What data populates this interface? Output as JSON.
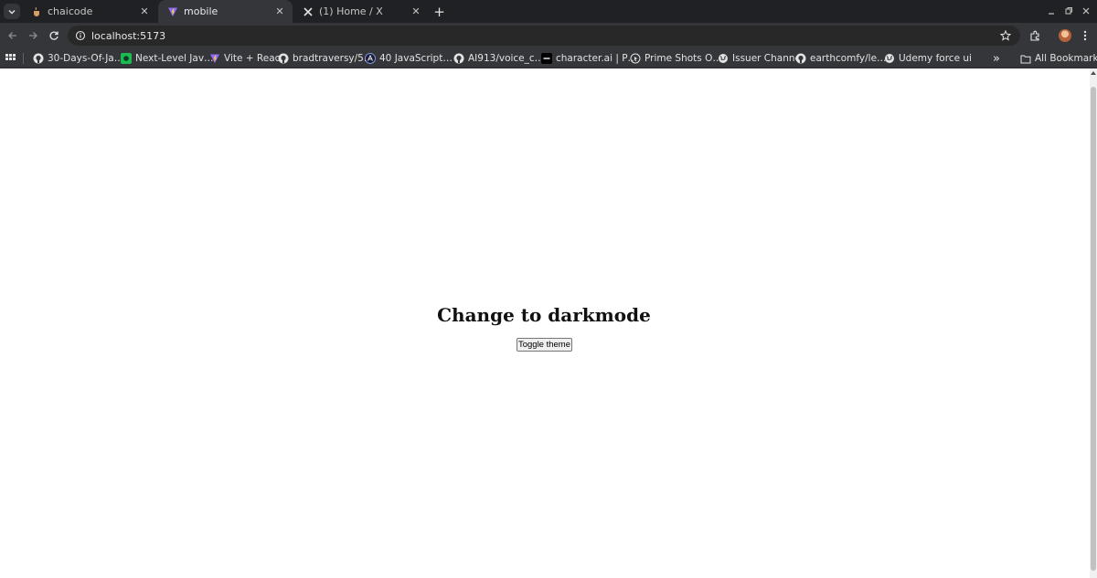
{
  "browser": {
    "tabs": [
      {
        "title": "chaicode",
        "favicon": "chaicode-icon",
        "active": false
      },
      {
        "title": "mobile",
        "favicon": "vite-icon",
        "active": true
      },
      {
        "title": "(1) Home / X",
        "favicon": "x-logo-icon",
        "active": false
      }
    ],
    "new_tab_label": "+",
    "url": "localhost:5173",
    "bookmarks": [
      {
        "label": "30-Days-Of-Ja…",
        "icon": "github-icon"
      },
      {
        "label": "Next-Level Jav…",
        "icon": "green-square-icon"
      },
      {
        "label": "Vite + React",
        "icon": "vite-icon"
      },
      {
        "label": "bradtraversy/5…",
        "icon": "github-icon"
      },
      {
        "label": "40 JavaScript…",
        "icon": "a-circle-icon"
      },
      {
        "label": "AI913/voice_c…",
        "icon": "github-icon"
      },
      {
        "label": "character.ai | P…",
        "icon": "character-ai-icon"
      },
      {
        "label": "Prime Shots O…",
        "icon": "play-circle-icon"
      },
      {
        "label": "Issuer Channel",
        "icon": "globe-icon"
      },
      {
        "label": "earthcomfy/le…",
        "icon": "github-icon"
      },
      {
        "label": "Udemy force ui",
        "icon": "globe-icon"
      }
    ],
    "overflow_label": "»",
    "all_bookmarks_label": "All Bookmarks"
  },
  "page": {
    "heading": "Change to darkmode",
    "toggle_button_label": "Toggle theme"
  },
  "colors": {
    "tab_strip": "#202124",
    "toolbar": "#35363a",
    "omnibox": "#282828",
    "page_background": "#ffffff",
    "heading_text": "#111111"
  }
}
